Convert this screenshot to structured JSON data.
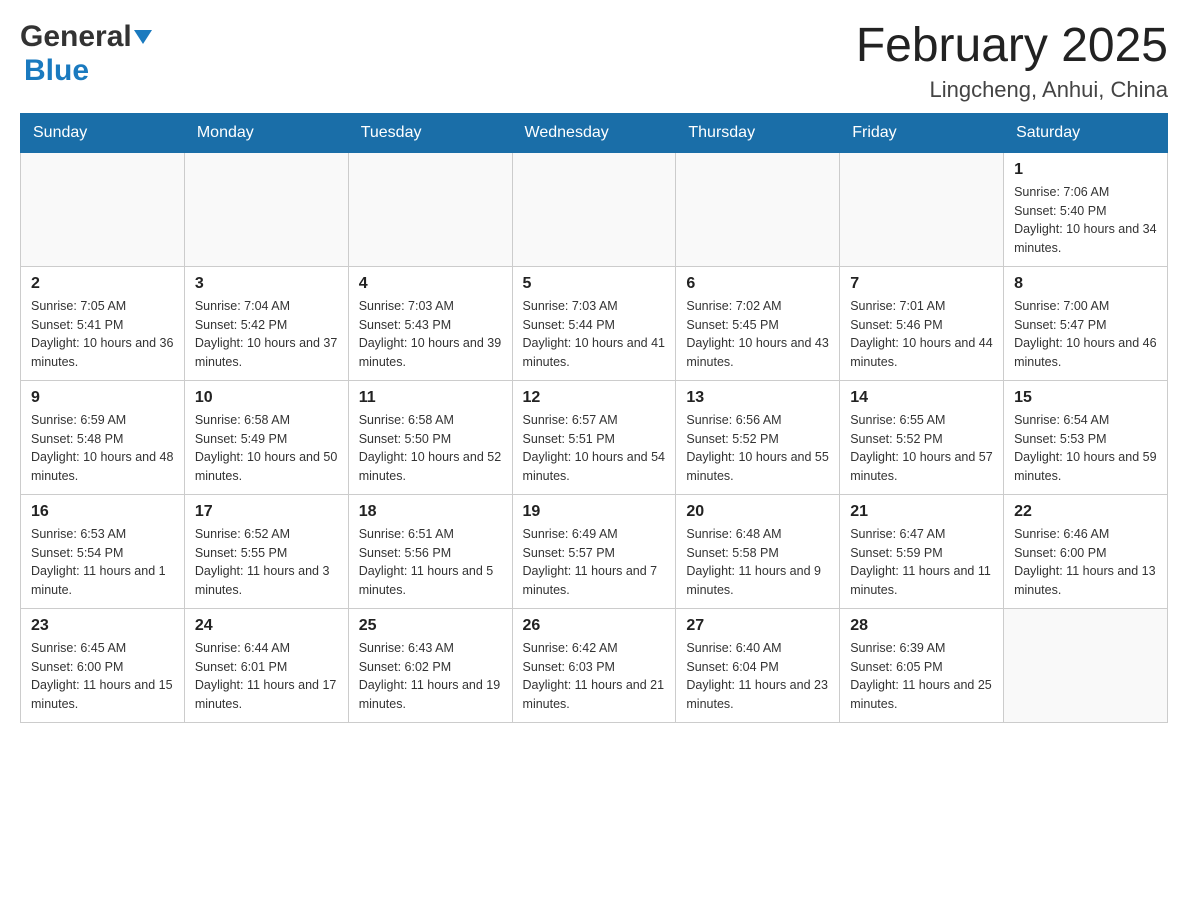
{
  "header": {
    "logo_general": "General",
    "logo_blue": "Blue",
    "month_title": "February 2025",
    "location": "Lingcheng, Anhui, China"
  },
  "weekdays": [
    "Sunday",
    "Monday",
    "Tuesday",
    "Wednesday",
    "Thursday",
    "Friday",
    "Saturday"
  ],
  "weeks": [
    [
      {
        "day": "",
        "sunrise": "",
        "sunset": "",
        "daylight": ""
      },
      {
        "day": "",
        "sunrise": "",
        "sunset": "",
        "daylight": ""
      },
      {
        "day": "",
        "sunrise": "",
        "sunset": "",
        "daylight": ""
      },
      {
        "day": "",
        "sunrise": "",
        "sunset": "",
        "daylight": ""
      },
      {
        "day": "",
        "sunrise": "",
        "sunset": "",
        "daylight": ""
      },
      {
        "day": "",
        "sunrise": "",
        "sunset": "",
        "daylight": ""
      },
      {
        "day": "1",
        "sunrise": "Sunrise: 7:06 AM",
        "sunset": "Sunset: 5:40 PM",
        "daylight": "Daylight: 10 hours and 34 minutes."
      }
    ],
    [
      {
        "day": "2",
        "sunrise": "Sunrise: 7:05 AM",
        "sunset": "Sunset: 5:41 PM",
        "daylight": "Daylight: 10 hours and 36 minutes."
      },
      {
        "day": "3",
        "sunrise": "Sunrise: 7:04 AM",
        "sunset": "Sunset: 5:42 PM",
        "daylight": "Daylight: 10 hours and 37 minutes."
      },
      {
        "day": "4",
        "sunrise": "Sunrise: 7:03 AM",
        "sunset": "Sunset: 5:43 PM",
        "daylight": "Daylight: 10 hours and 39 minutes."
      },
      {
        "day": "5",
        "sunrise": "Sunrise: 7:03 AM",
        "sunset": "Sunset: 5:44 PM",
        "daylight": "Daylight: 10 hours and 41 minutes."
      },
      {
        "day": "6",
        "sunrise": "Sunrise: 7:02 AM",
        "sunset": "Sunset: 5:45 PM",
        "daylight": "Daylight: 10 hours and 43 minutes."
      },
      {
        "day": "7",
        "sunrise": "Sunrise: 7:01 AM",
        "sunset": "Sunset: 5:46 PM",
        "daylight": "Daylight: 10 hours and 44 minutes."
      },
      {
        "day": "8",
        "sunrise": "Sunrise: 7:00 AM",
        "sunset": "Sunset: 5:47 PM",
        "daylight": "Daylight: 10 hours and 46 minutes."
      }
    ],
    [
      {
        "day": "9",
        "sunrise": "Sunrise: 6:59 AM",
        "sunset": "Sunset: 5:48 PM",
        "daylight": "Daylight: 10 hours and 48 minutes."
      },
      {
        "day": "10",
        "sunrise": "Sunrise: 6:58 AM",
        "sunset": "Sunset: 5:49 PM",
        "daylight": "Daylight: 10 hours and 50 minutes."
      },
      {
        "day": "11",
        "sunrise": "Sunrise: 6:58 AM",
        "sunset": "Sunset: 5:50 PM",
        "daylight": "Daylight: 10 hours and 52 minutes."
      },
      {
        "day": "12",
        "sunrise": "Sunrise: 6:57 AM",
        "sunset": "Sunset: 5:51 PM",
        "daylight": "Daylight: 10 hours and 54 minutes."
      },
      {
        "day": "13",
        "sunrise": "Sunrise: 6:56 AM",
        "sunset": "Sunset: 5:52 PM",
        "daylight": "Daylight: 10 hours and 55 minutes."
      },
      {
        "day": "14",
        "sunrise": "Sunrise: 6:55 AM",
        "sunset": "Sunset: 5:52 PM",
        "daylight": "Daylight: 10 hours and 57 minutes."
      },
      {
        "day": "15",
        "sunrise": "Sunrise: 6:54 AM",
        "sunset": "Sunset: 5:53 PM",
        "daylight": "Daylight: 10 hours and 59 minutes."
      }
    ],
    [
      {
        "day": "16",
        "sunrise": "Sunrise: 6:53 AM",
        "sunset": "Sunset: 5:54 PM",
        "daylight": "Daylight: 11 hours and 1 minute."
      },
      {
        "day": "17",
        "sunrise": "Sunrise: 6:52 AM",
        "sunset": "Sunset: 5:55 PM",
        "daylight": "Daylight: 11 hours and 3 minutes."
      },
      {
        "day": "18",
        "sunrise": "Sunrise: 6:51 AM",
        "sunset": "Sunset: 5:56 PM",
        "daylight": "Daylight: 11 hours and 5 minutes."
      },
      {
        "day": "19",
        "sunrise": "Sunrise: 6:49 AM",
        "sunset": "Sunset: 5:57 PM",
        "daylight": "Daylight: 11 hours and 7 minutes."
      },
      {
        "day": "20",
        "sunrise": "Sunrise: 6:48 AM",
        "sunset": "Sunset: 5:58 PM",
        "daylight": "Daylight: 11 hours and 9 minutes."
      },
      {
        "day": "21",
        "sunrise": "Sunrise: 6:47 AM",
        "sunset": "Sunset: 5:59 PM",
        "daylight": "Daylight: 11 hours and 11 minutes."
      },
      {
        "day": "22",
        "sunrise": "Sunrise: 6:46 AM",
        "sunset": "Sunset: 6:00 PM",
        "daylight": "Daylight: 11 hours and 13 minutes."
      }
    ],
    [
      {
        "day": "23",
        "sunrise": "Sunrise: 6:45 AM",
        "sunset": "Sunset: 6:00 PM",
        "daylight": "Daylight: 11 hours and 15 minutes."
      },
      {
        "day": "24",
        "sunrise": "Sunrise: 6:44 AM",
        "sunset": "Sunset: 6:01 PM",
        "daylight": "Daylight: 11 hours and 17 minutes."
      },
      {
        "day": "25",
        "sunrise": "Sunrise: 6:43 AM",
        "sunset": "Sunset: 6:02 PM",
        "daylight": "Daylight: 11 hours and 19 minutes."
      },
      {
        "day": "26",
        "sunrise": "Sunrise: 6:42 AM",
        "sunset": "Sunset: 6:03 PM",
        "daylight": "Daylight: 11 hours and 21 minutes."
      },
      {
        "day": "27",
        "sunrise": "Sunrise: 6:40 AM",
        "sunset": "Sunset: 6:04 PM",
        "daylight": "Daylight: 11 hours and 23 minutes."
      },
      {
        "day": "28",
        "sunrise": "Sunrise: 6:39 AM",
        "sunset": "Sunset: 6:05 PM",
        "daylight": "Daylight: 11 hours and 25 minutes."
      },
      {
        "day": "",
        "sunrise": "",
        "sunset": "",
        "daylight": ""
      }
    ]
  ]
}
